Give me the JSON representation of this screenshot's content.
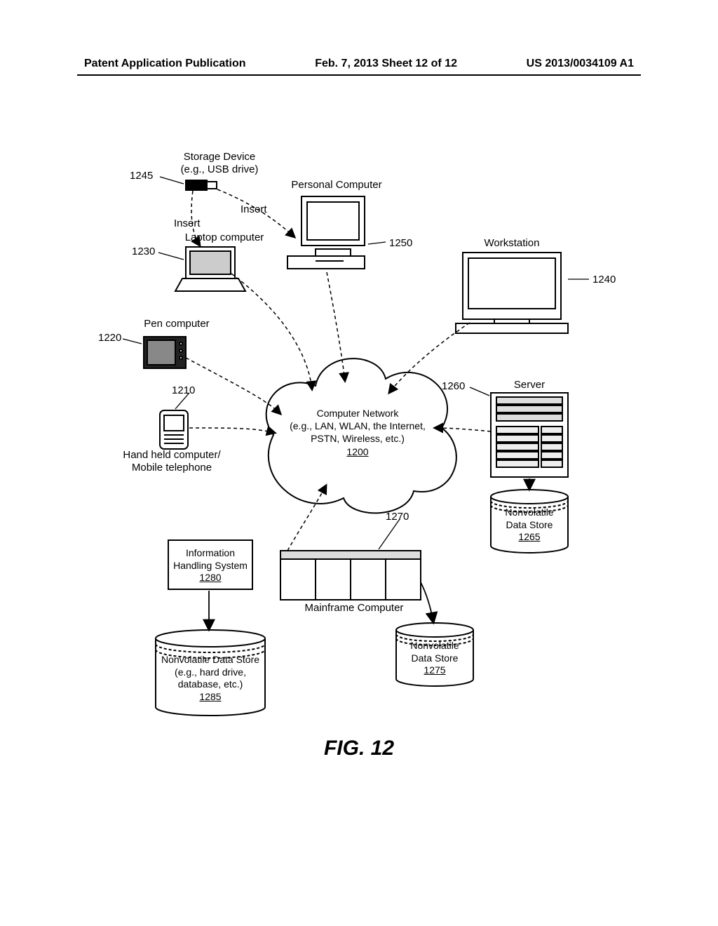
{
  "header": {
    "left": "Patent Application Publication",
    "center": "Feb. 7, 2013   Sheet 12 of 12",
    "right": "US 2013/0034109 A1"
  },
  "labels": {
    "storage_device": "Storage Device\n(e.g., USB drive)",
    "personal_computer": "Personal Computer",
    "workstation": "Workstation",
    "laptop": "Laptop computer",
    "pen": "Pen computer",
    "handheld": "Hand held computer/\nMobile telephone",
    "server": "Server",
    "mainframe": "Mainframe Computer",
    "insert1": "Insert",
    "insert2": "Insert"
  },
  "refs": {
    "r1200": "1200",
    "r1210": "1210",
    "r1220": "1220",
    "r1230": "1230",
    "r1240": "1240",
    "r1245": "1245",
    "r1250": "1250",
    "r1260": "1260",
    "r1265": "1265",
    "r1270": "1270",
    "r1275": "1275",
    "r1280": "1280",
    "r1285": "1285"
  },
  "cloud": {
    "line1": "Computer Network",
    "line2": "(e.g., LAN, WLAN, the Internet,",
    "line3": "PSTN, Wireless, etc.)"
  },
  "ihs": {
    "line1": "Information",
    "line2": "Handling System"
  },
  "nvds_server": {
    "line1": "Nonvolatile",
    "line2": "Data Store"
  },
  "nvds_mainframe": {
    "line1": "Nonvolatile",
    "line2": "Data Store"
  },
  "nvds_ihs": {
    "line1": "Nonvolatile Data Store",
    "line2": "(e.g., hard drive,",
    "line3": "database, etc.)"
  },
  "figure": "FIG. 12"
}
